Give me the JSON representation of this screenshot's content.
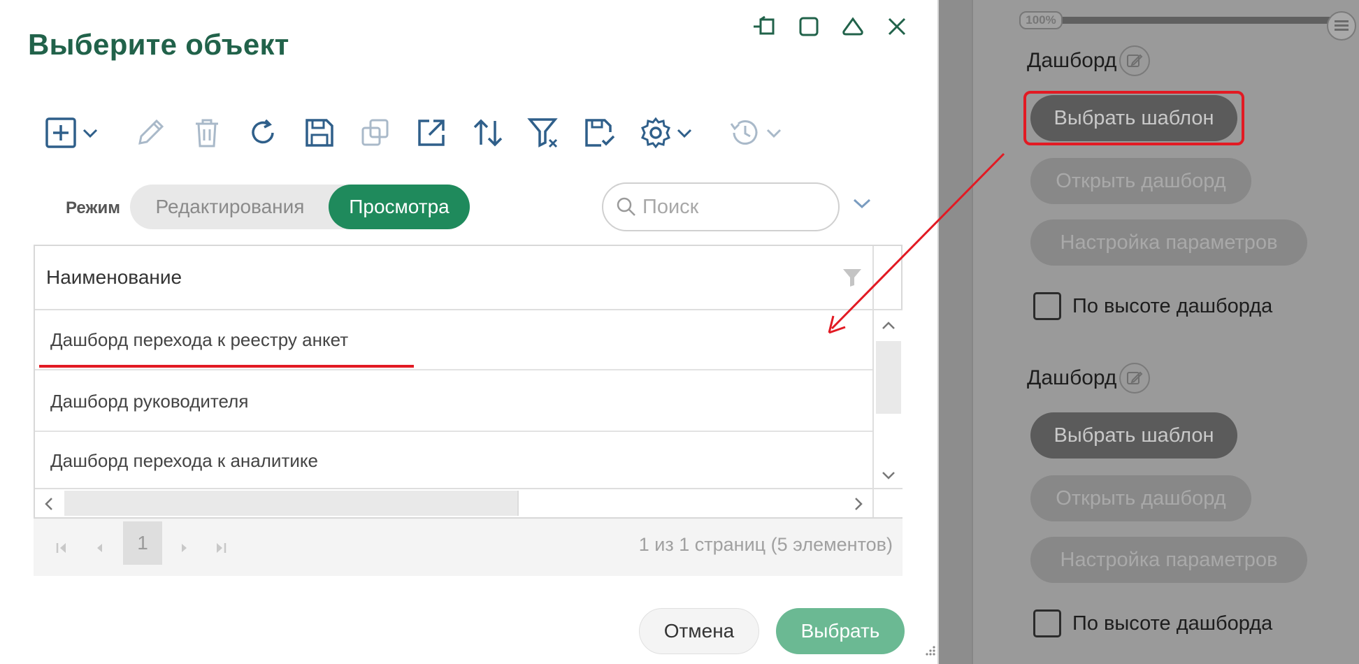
{
  "dialog": {
    "title": "Выберите объект",
    "mode_label": "Режим",
    "mode_options": {
      "edit": "Редактирования",
      "view": "Просмотра"
    },
    "search_placeholder": "Поиск",
    "grid": {
      "column_header": "Наименование",
      "rows": [
        "Дашборд перехода к реестру анкет",
        "Дашборд руководителя",
        "Дашборд перехода к аналитике"
      ]
    },
    "pager": {
      "current_page": "1",
      "info": "1 из 1 страниц (5 элементов)"
    },
    "buttons": {
      "cancel": "Отмена",
      "select": "Выбрать"
    },
    "accent_color": "#1f8a5c",
    "title_color": "#21624a"
  },
  "backdrop": {
    "zoom_label": "100%",
    "sections": [
      {
        "label": "Дашборд",
        "buttons": [
          "Выбрать шаблон",
          "Открыть дашборд",
          "Настройка параметров"
        ],
        "checkbox_label": "По высоте дашборда"
      },
      {
        "label": "Дашборд",
        "buttons": [
          "Выбрать шаблон",
          "Открыть дашборд",
          "Настройка параметров"
        ],
        "checkbox_label": "По высоте дашборда"
      }
    ],
    "highlight_color": "#e21a23"
  }
}
